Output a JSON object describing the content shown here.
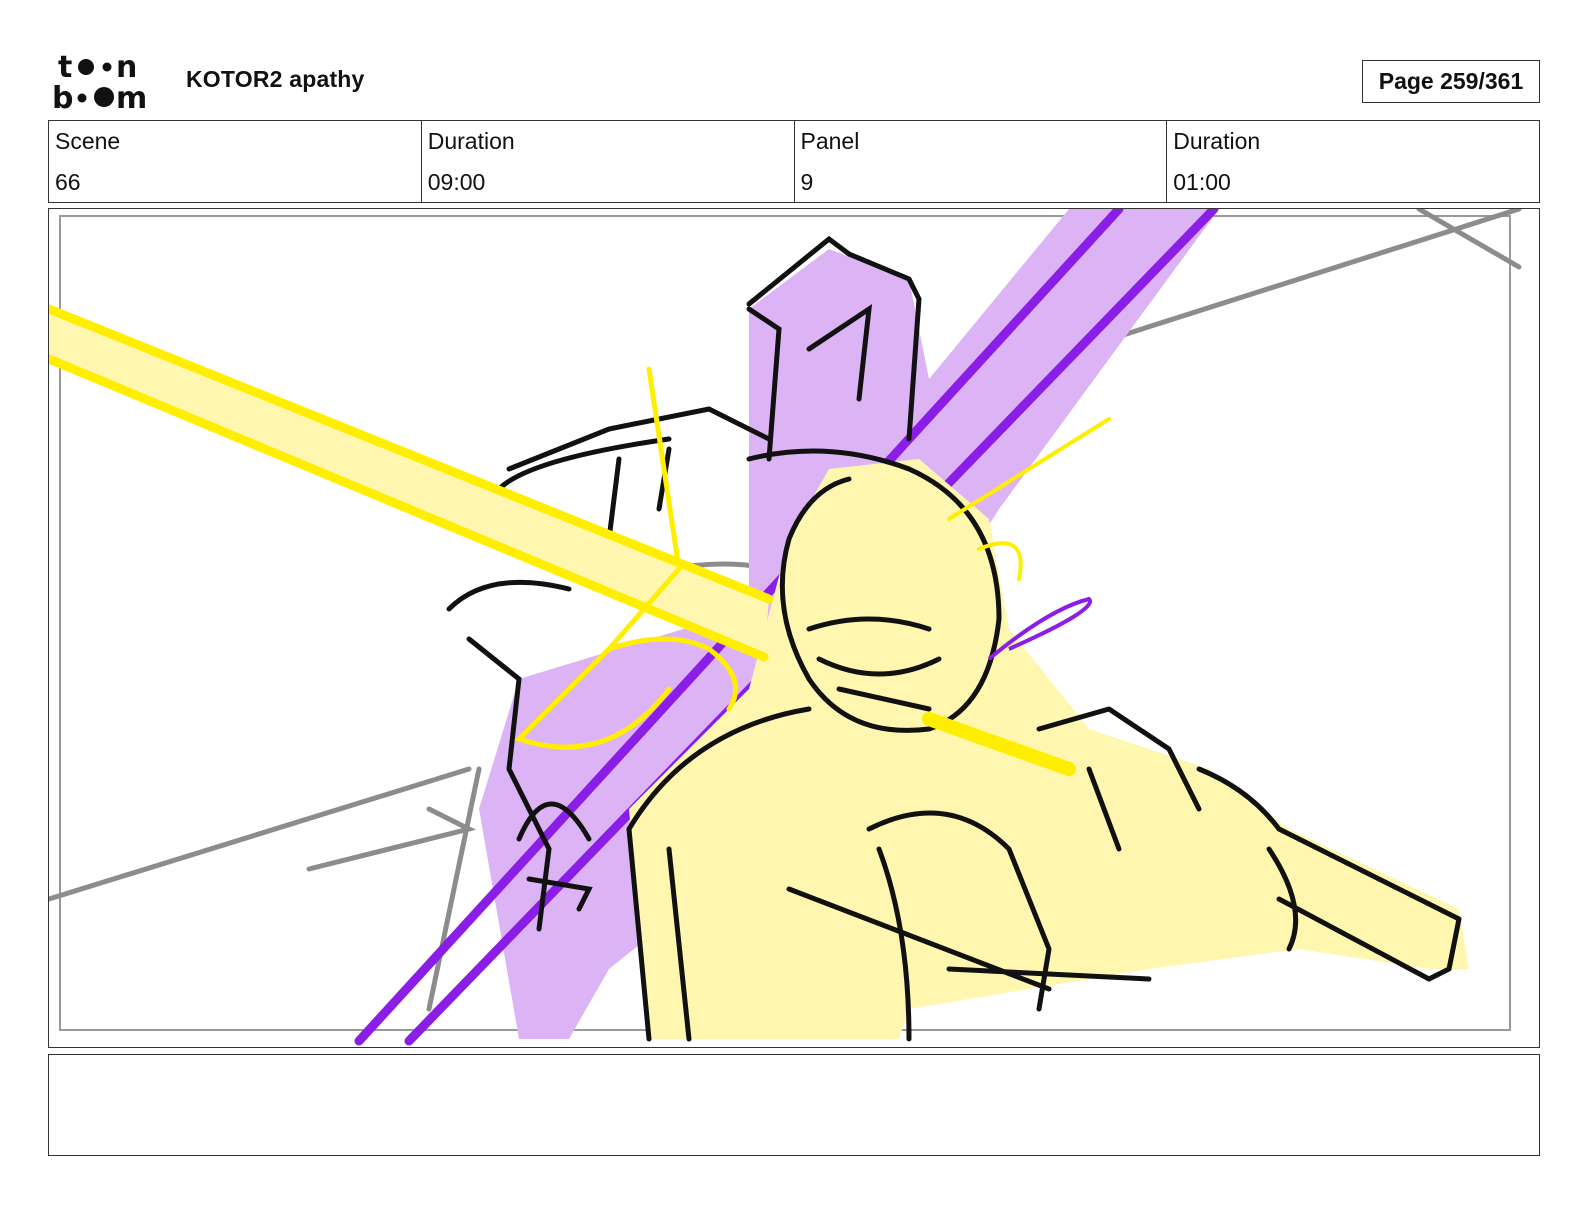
{
  "header": {
    "logo_name": "toon-boom-logo",
    "project_title": "KOTOR2 apathy",
    "page_label": "Page 259/361"
  },
  "info": {
    "scene_label": "Scene",
    "scene_value": "66",
    "scene_duration_label": "Duration",
    "scene_duration_value": "09:00",
    "panel_label": "Panel",
    "panel_value": "9",
    "panel_duration_label": "Duration",
    "panel_duration_value": "01:00"
  },
  "colors": {
    "purple_fill": "#dcb4f5",
    "purple_saber": "#8a1ee6",
    "yellow_fill": "#fff7b0",
    "yellow_saber": "#ffee00",
    "sketch_grey": "#8c8c8c",
    "ink": "#111111"
  },
  "notes": {
    "text": ""
  }
}
